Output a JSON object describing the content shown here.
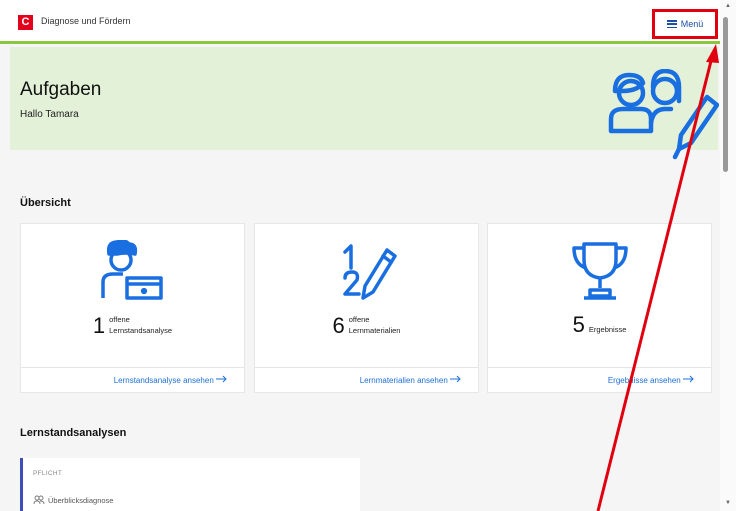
{
  "header": {
    "logo_letter": "C",
    "app_title": "Diagnose und Fördern",
    "menu_label": "Menü",
    "menu_icon": "hamburger-icon"
  },
  "hero": {
    "title": "Aufgaben",
    "greeting": "Hallo Tamara",
    "illustration": "people-pencil-icon"
  },
  "overview": {
    "title": "Übersicht",
    "cards": [
      {
        "icon": "student-screen-icon",
        "count": "1",
        "line1": "offene",
        "line2": "Lernstandsanalyse",
        "link": "Lernstandsanalyse ansehen"
      },
      {
        "icon": "numbers-pencil-icon",
        "count": "6",
        "line1": "offene",
        "line2": "Lernmaterialien",
        "link": "Lernmaterialien ansehen"
      },
      {
        "icon": "trophy-icon",
        "count": "5",
        "line1": "",
        "line2": "Ergebnisse",
        "link": "Ergebnisse ansehen"
      }
    ]
  },
  "analyses": {
    "title": "Lernstandsanalysen",
    "items": [
      {
        "tag": "PFLICHT",
        "name": "Überblicksdiagnose",
        "icon": "people-icon"
      }
    ]
  },
  "colors": {
    "accent_blue": "#1d6fd6",
    "icon_blue": "#1a6fe0",
    "brand_red": "#e2001a",
    "header_line_green": "#8cc63f",
    "hero_bg": "#e3f1d9",
    "annotation_red": "#e0000f"
  }
}
